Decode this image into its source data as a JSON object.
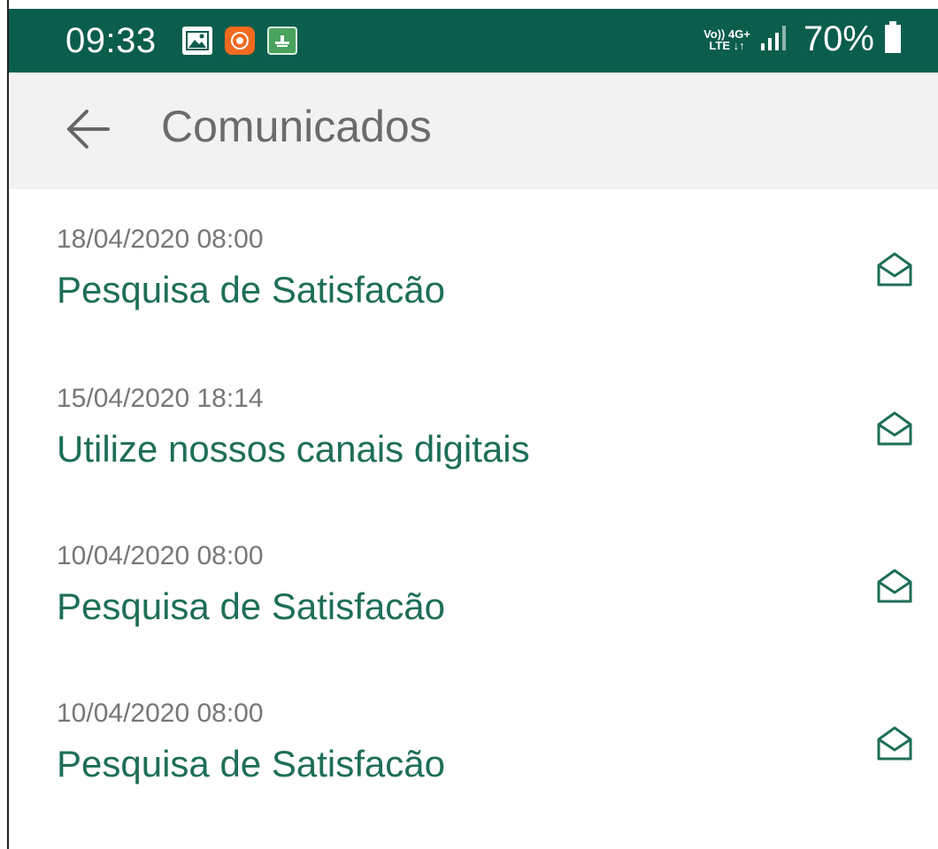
{
  "status_bar": {
    "time": "09:33",
    "network_label_top": "Vo)) 4G+",
    "network_label_bottom": "LTE ↓↑",
    "battery": "70%",
    "background_color": "#0b5d4c"
  },
  "notification_icons": [
    "gallery-icon",
    "orange-app-icon",
    "green-app-icon"
  ],
  "appbar": {
    "title": "Comunicados",
    "back_icon": "back-arrow-icon"
  },
  "messages": [
    {
      "date": "18/04/2020 08:00",
      "title": "Pesquisa de Satisfacão",
      "icon": "envelope-open-icon"
    },
    {
      "date": "15/04/2020 18:14",
      "title": "Utilize nossos canais digitais",
      "icon": "envelope-open-icon"
    },
    {
      "date": "10/04/2020 08:00",
      "title": "Pesquisa de Satisfacão",
      "icon": "envelope-open-icon"
    },
    {
      "date": "10/04/2020 08:00",
      "title": "Pesquisa de Satisfacão",
      "icon": "envelope-open-icon"
    }
  ],
  "colors": {
    "accent": "#1e6e58",
    "title_gray": "#6b6b6b",
    "date_gray": "#777777"
  }
}
